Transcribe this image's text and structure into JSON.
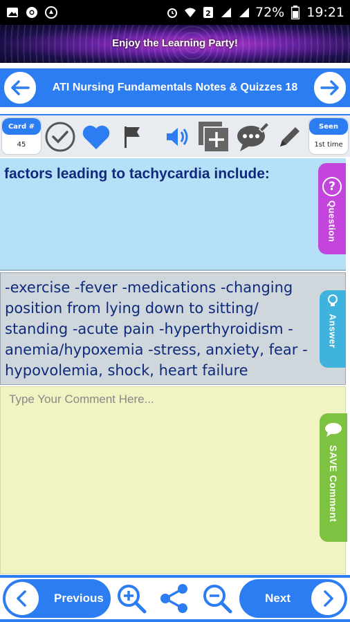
{
  "status_bar": {
    "battery_percent": "72%",
    "time": "19:21",
    "icons": [
      "image-icon",
      "chrome-icon",
      "app-icon",
      "alarm-icon",
      "wifi-icon",
      "sim-2-icon",
      "signal-icon",
      "signal-icon",
      "battery-icon"
    ]
  },
  "banner": {
    "text": "Enjoy the Learning Party!"
  },
  "header": {
    "title": "ATI  Nursing Fundamentals  Notes & Quizzes 18"
  },
  "toolbar": {
    "card_label": "Card #",
    "card_value": "45",
    "seen_label": "Seen",
    "seen_value": "1st time",
    "icons": [
      "check-icon",
      "heart-icon",
      "flag-icon",
      "speaker-icon",
      "add-copy-icon",
      "comment-icon",
      "edit-icon"
    ]
  },
  "question": {
    "tab_label": "Question",
    "text": "factors leading to tachycardia include:"
  },
  "answer": {
    "tab_label": "Answer",
    "text": "-exercise -fever -medications -changing position from lying down to sitting/ standing -acute pain -hyperthyroidism -anemia/hypoxemia -stress, anxiety, fear -hypovolemia, shock, heart failure"
  },
  "comment": {
    "placeholder": "Type Your Comment Here...",
    "value": "",
    "tab_label": "SAVE Comment"
  },
  "bottom": {
    "previous_label": "Previous",
    "next_label": "Next"
  },
  "colors": {
    "primary": "#2c7df2",
    "question_bg": "#b6dff8",
    "answer_bg": "#cfd6dc",
    "comment_bg": "#f2f3c2",
    "question_tab": "#c445dc",
    "answer_tab": "#3fb2dd",
    "comment_tab": "#7dc241",
    "text_blue": "#0e2b7b"
  }
}
